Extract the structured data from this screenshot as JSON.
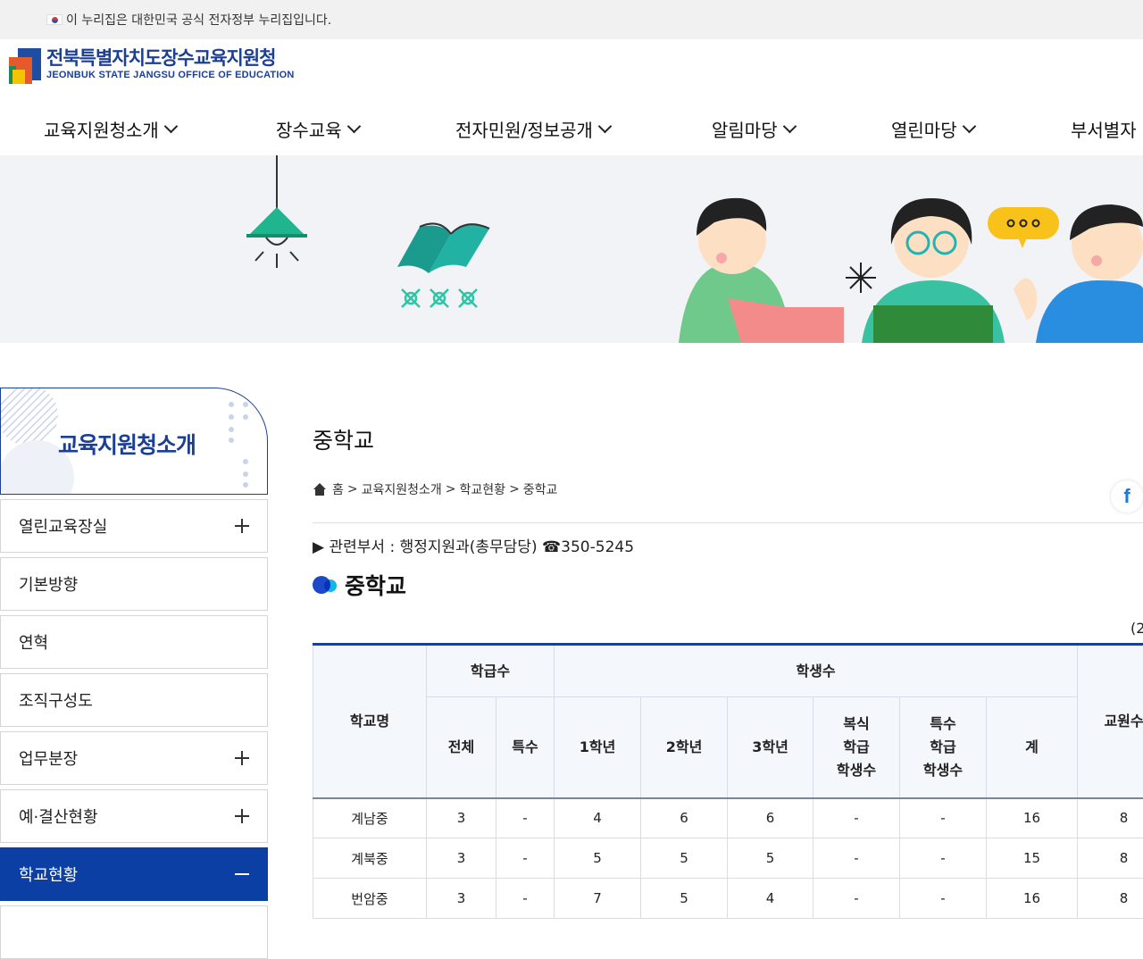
{
  "gov_banner": {
    "text": "이 누리집은 대한민국 공식 전자정부 누리집입니다."
  },
  "logo": {
    "title": "전북특별자치도장수교육지원청",
    "subtitle": "JEONBUK STATE JANGSU OFFICE OF EDUCATION"
  },
  "gnb": [
    {
      "label": "교육지원청소개"
    },
    {
      "label": "장수교육"
    },
    {
      "label": "전자민원/정보공개"
    },
    {
      "label": "알림마당"
    },
    {
      "label": "열린마당"
    },
    {
      "label": "부서별자"
    }
  ],
  "sidebar": {
    "title": "교육지원청소개",
    "items": [
      {
        "label": "열린교육장실",
        "expandable": true
      },
      {
        "label": "기본방향",
        "expandable": false
      },
      {
        "label": "연혁",
        "expandable": false
      },
      {
        "label": "조직구성도",
        "expandable": false
      },
      {
        "label": "업무분장",
        "expandable": true
      },
      {
        "label": "예·결산현황",
        "expandable": true
      },
      {
        "label": "학교현황",
        "active": true
      }
    ]
  },
  "content": {
    "page_title": "중학교",
    "breadcrumb": [
      "홈",
      "교육지원청소개",
      "학교현황",
      "중학교"
    ],
    "breadcrumb_sep": ">",
    "department": "▶ 관련부서 : 행정지원과(총무담당) ☎350-5245",
    "section_title": "중학교",
    "unit_note": "(2",
    "facebook_glyph": "f"
  },
  "table": {
    "headers": {
      "school": "학교명",
      "classes": "학급수",
      "students": "학생수",
      "teachers": "교원수",
      "total": "전체",
      "special": "특수",
      "grade1": "1학년",
      "grade2": "2학년",
      "grade3": "3학년",
      "multi": [
        "복식",
        "학급",
        "학생수"
      ],
      "special_students": [
        "특수",
        "학급",
        "학생수"
      ],
      "sum": "계"
    },
    "rows": [
      {
        "name": "계남중",
        "total": "3",
        "special": "-",
        "g1": "4",
        "g2": "6",
        "g3": "6",
        "multi": "-",
        "sp": "-",
        "sum": "16",
        "teachers": "8"
      },
      {
        "name": "계북중",
        "total": "3",
        "special": "-",
        "g1": "5",
        "g2": "5",
        "g3": "5",
        "multi": "-",
        "sp": "-",
        "sum": "15",
        "teachers": "8"
      },
      {
        "name": "번암중",
        "total": "3",
        "special": "-",
        "g1": "7",
        "g2": "5",
        "g3": "4",
        "multi": "-",
        "sp": "-",
        "sum": "16",
        "teachers": "8"
      }
    ]
  },
  "colors": {
    "brand_blue": "#1b3f94",
    "active_blue": "#0b3fa3",
    "visual_bg": "#f1f3f6"
  }
}
